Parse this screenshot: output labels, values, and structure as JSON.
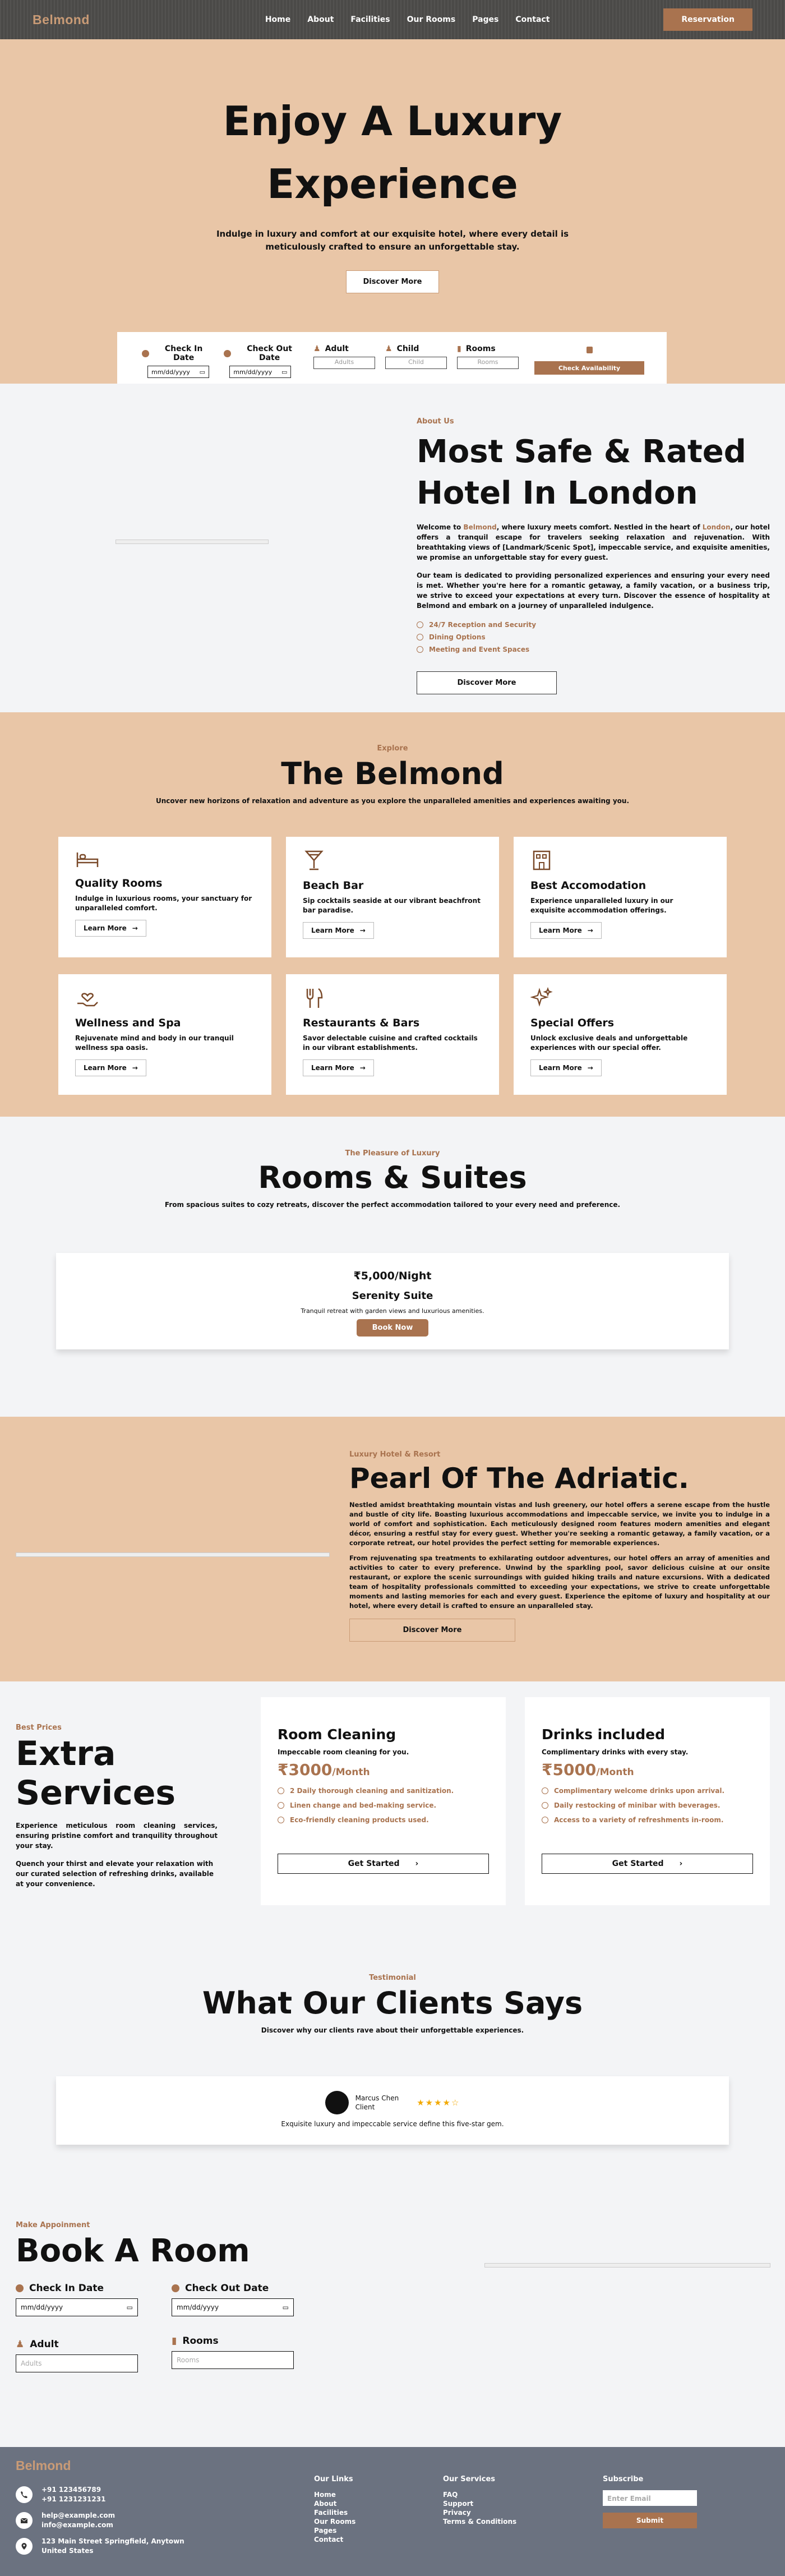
{
  "nav": {
    "brand": "Belmond",
    "links": [
      "Home",
      "About",
      "Facilities",
      "Our Rooms",
      "Pages",
      "Contact"
    ],
    "cta": "Reservation"
  },
  "hero": {
    "title_line1": "Enjoy A Luxury",
    "title_line2": "Experience",
    "subtitle_line1": "Indulge in luxury and comfort at our exquisite hotel, where every detail is",
    "subtitle_line2": "meticulously crafted to ensure an unforgettable stay.",
    "cta": "Discover More",
    "booking": {
      "checkin_label": "Check In Date",
      "checkout_label": "Check Out Date",
      "adult_label": "Adult",
      "child_label": "Child",
      "rooms_label": "Rooms",
      "date_placeholder": "mm/dd/yyyy",
      "adult_placeholder": "Adults",
      "child_placeholder": "Child",
      "rooms_placeholder": "Rooms",
      "submit": "Check Availability"
    }
  },
  "about": {
    "eyebrow": "About Us",
    "title_line1": "Most Safe & Rated",
    "title_line2": "Hotel In London",
    "p1_a": "Welcome to ",
    "p1_brand": "Belmond",
    "p1_b": ", where luxury meets comfort. Nestled in the heart of ",
    "p1_city": "London",
    "p1_c": ", our hotel offers a tranquil escape for travelers seeking relaxation and rejuvenation. With breathtaking views of [Landmark/Scenic Spot], impeccable service, and exquisite amenities, we promise an unforgettable stay for every guest.",
    "p2": "Our team is dedicated to providing personalized experiences and ensuring your every need is met. Whether you're here for a romantic getaway, a family vacation, or a business trip, we strive to exceed your expectations at every turn. Discover the essence of hospitality at Belmond and embark on a journey of unparalleled indulgence.",
    "features": [
      "24/7 Reception and Security",
      "Dining Options",
      "Meeting and Event Spaces"
    ],
    "cta": "Discover More"
  },
  "explore": {
    "eyebrow": "Explore",
    "title": "The Belmond",
    "subtitle": "Uncover new horizons of relaxation and adventure as you explore the unparalleled amenities and experiences awaiting you.",
    "cards": [
      {
        "title": "Quality Rooms",
        "text": "Indulge in luxurious rooms, your sanctuary for unparalleled comfort.",
        "cta": "Learn More"
      },
      {
        "title": "Beach Bar",
        "text": "Sip cocktails seaside at our vibrant beachfront bar paradise.",
        "cta": "Learn More"
      },
      {
        "title": "Best Accomodation",
        "text": "Experience unparalleled luxury in our exquisite accommodation offerings.",
        "cta": "Learn More"
      },
      {
        "title": "Wellness and Spa",
        "text": "Rejuvenate mind and body in our tranquil wellness spa oasis.",
        "cta": "Learn More"
      },
      {
        "title": "Restaurants & Bars",
        "text": "Savor delectable cuisine and crafted cocktails in our vibrant establishments.",
        "cta": "Learn More"
      },
      {
        "title": "Special Offers",
        "text": "Unlock exclusive deals and unforgettable experiences with our special offer.",
        "cta": "Learn More"
      }
    ]
  },
  "rooms": {
    "eyebrow": "The Pleasure of Luxury",
    "title": "Rooms & Suites",
    "subtitle": "From spacious suites to cozy retreats, discover the perfect accommodation tailored to your every need and preference.",
    "card": {
      "price": "₹5,000/Night",
      "name": "Serenity Suite",
      "desc": "Tranquil retreat with garden views and luxurious amenities.",
      "cta": "Book Now"
    }
  },
  "pearl": {
    "eyebrow": "Luxury Hotel & Resort",
    "title": "Pearl Of The Adriatic.",
    "p1": "Nestled amidst breathtaking mountain vistas and lush greenery, our hotel offers a serene escape from the hustle and bustle of city life. Boasting luxurious accommodations and impeccable service, we invite you to indulge in a world of comfort and sophistication. Each meticulously designed room features modern amenities and elegant décor, ensuring a restful stay for every guest. Whether you're seeking a romantic getaway, a family vacation, or a corporate retreat, our hotel provides the perfect setting for memorable experiences.",
    "p2": "From rejuvenating spa treatments to exhilarating outdoor adventures, our hotel offers an array of amenities and activities to cater to every preference. Unwind by the sparkling pool, savor delicious cuisine at our onsite restaurant, or explore the scenic surroundings with guided hiking trails and nature excursions. With a dedicated team of hospitality professionals committed to exceeding your expectations, we strive to create unforgettable moments and lasting memories for each and every guest. Experience the epitome of luxury and hospitality at our hotel, where every detail is crafted to ensure an unparalleled stay.",
    "cta": "Discover More"
  },
  "extra": {
    "eyebrow": "Best Prices",
    "title_line1": "Extra",
    "title_line2": "Services",
    "p1": "Experience meticulous room cleaning services, ensuring pristine comfort and tranquility throughout your stay.",
    "p2": "Quench your thirst and elevate your relaxation with our curated selection of refreshing drinks, available at your convenience.",
    "services": [
      {
        "title": "Room Cleaning",
        "subtitle": "Impeccable room cleaning for you.",
        "price": "₹3000",
        "period": "/Month",
        "items": [
          "2 Daily thorough cleaning and sanitization.",
          "Linen change and bed-making service.",
          "Eco-friendly cleaning products used."
        ],
        "cta": "Get Started"
      },
      {
        "title": "Drinks included",
        "subtitle": "Complimentary drinks with every stay.",
        "price": "₹5000",
        "period": "/Month",
        "items": [
          "Complimentary welcome drinks upon arrival.",
          "Daily restocking of minibar with beverages.",
          "Access to a variety of refreshments in-room."
        ],
        "cta": "Get Started"
      }
    ]
  },
  "testimonial": {
    "eyebrow": "Testimonial",
    "title": "What Our Clients Says",
    "subtitle": "Discover why our clients rave about their unforgettable experiences.",
    "name": "Marcus Chen",
    "role": "Client",
    "stars": "★★★★☆",
    "quote": "Exquisite luxury and impeccable service define this five-star gem."
  },
  "book": {
    "eyebrow": "Make Appoinment",
    "title": "Book A Room",
    "checkin_label": "Check In Date",
    "checkout_label": "Check Out Date",
    "adult_label": "Adult",
    "rooms_label": "Rooms",
    "date_value": "mm/dd/yyyy",
    "adult_placeholder": "Adults",
    "rooms_placeholder": "Rooms"
  },
  "footer": {
    "brand": "Belmond",
    "phone1": "+91 123456789",
    "phone2": "+91 1231231231",
    "email1": "help@example.com",
    "email2": "info@example.com",
    "address1": "123 Main Street Springfield, Anytown",
    "address2": "United States",
    "links_title": "Our Links",
    "links": [
      "Home",
      "About",
      "Facilities",
      "Our Rooms",
      "Pages",
      "Contact"
    ],
    "services_title": "Our Services",
    "services": [
      "FAQ",
      "Support",
      "Privacy",
      "Terms & Conditions"
    ],
    "subscribe_title": "Subscribe",
    "email_placeholder": "Enter Email",
    "subscribe_cta": "Submit"
  },
  "colors": {
    "accent": "#a9734f",
    "sand": "#e9c6a7",
    "nav": "#4b4a48",
    "footer": "#6b7280",
    "page": "#f3f4f6"
  }
}
